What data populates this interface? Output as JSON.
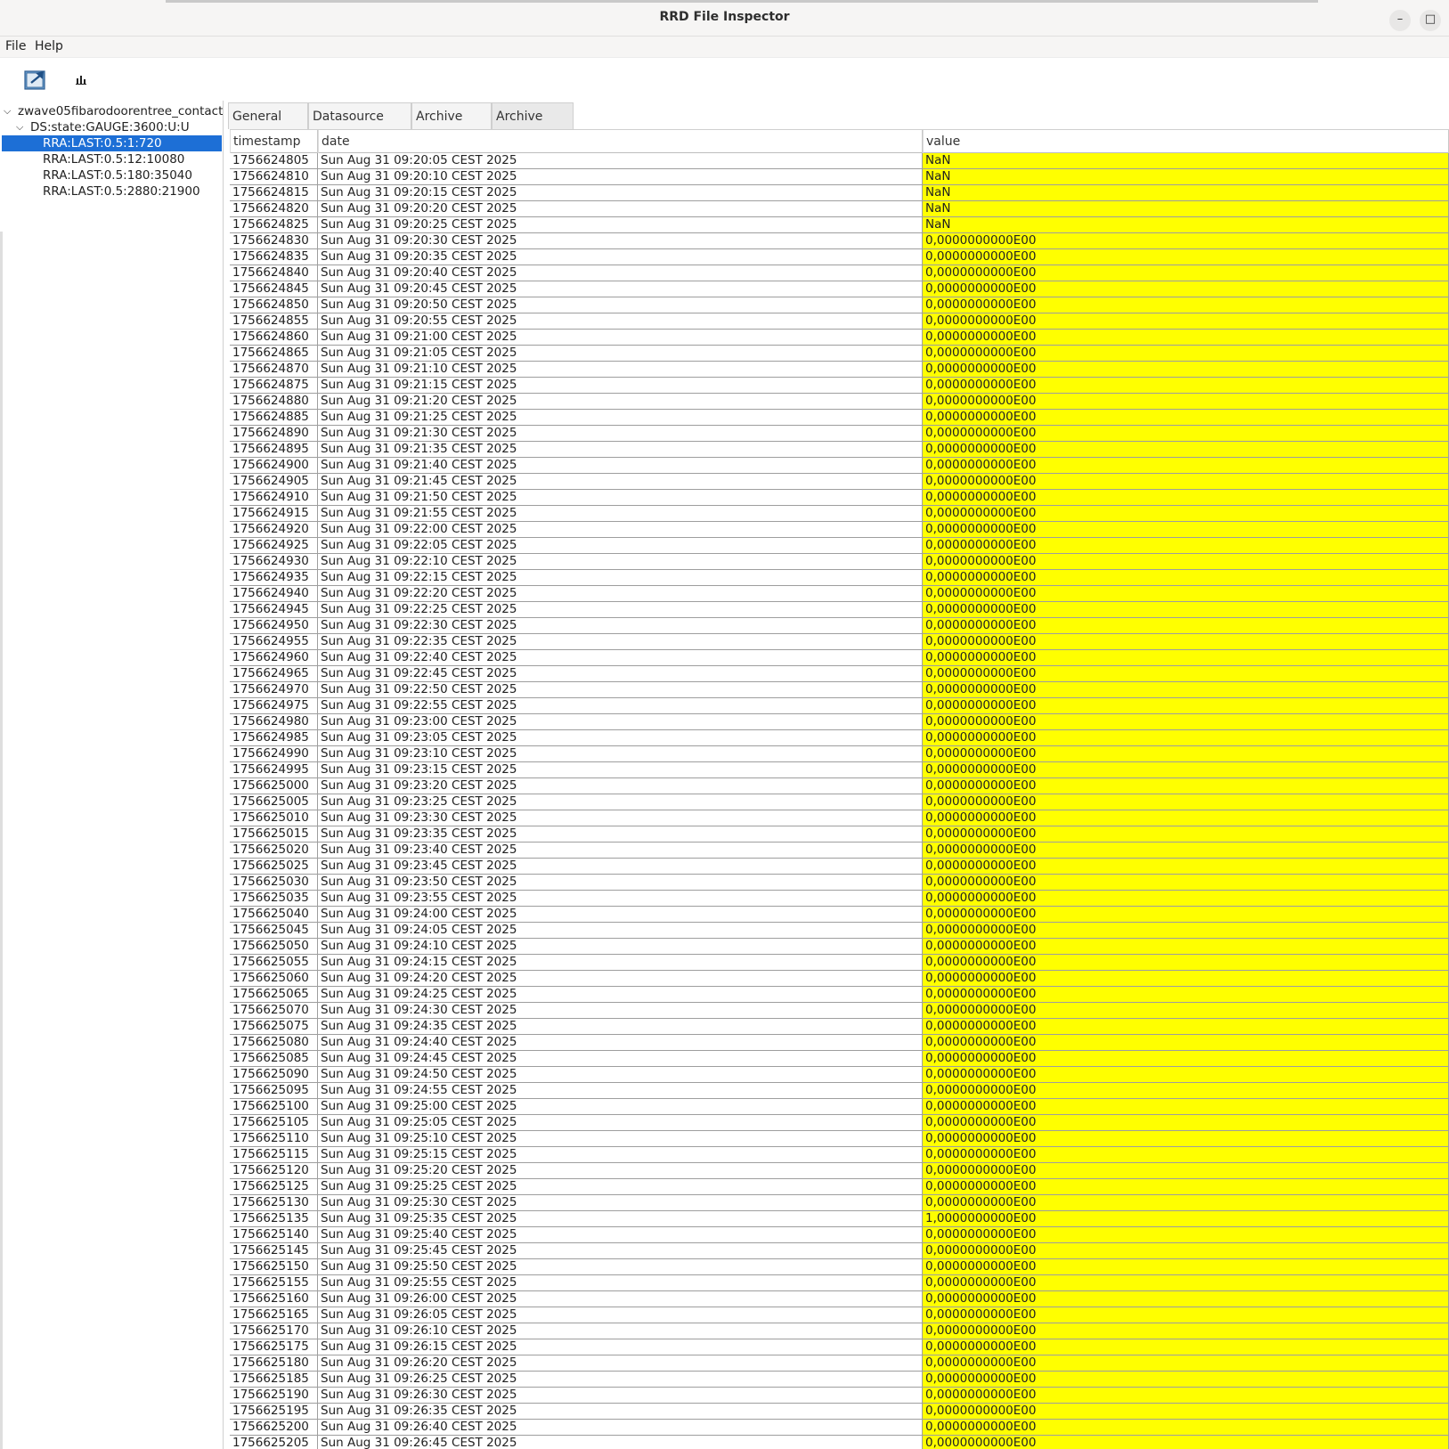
{
  "window": {
    "title": "RRD File Inspector",
    "minimize_glyph": "–",
    "maximize_glyph": "□"
  },
  "menu": {
    "file": "File",
    "help": "Help"
  },
  "toolbar": {
    "open_icon": "open-file-icon",
    "chart_icon": "bar-chart-icon"
  },
  "tree": {
    "root": "zwave05fibarodoorentree_contact",
    "ds": "DS:state:GAUGE:3600:U:U",
    "rras": [
      "RRA:LAST:0.5:1:720",
      "RRA:LAST:0.5:12:10080",
      "RRA:LAST:0.5:180:35040",
      "RRA:LAST:0.5:2880:21900"
    ],
    "selected_index": 0
  },
  "tabs": [
    "General info",
    "Datasource info",
    "Archive info",
    "Archive data"
  ],
  "active_tab": 3,
  "table": {
    "columns": [
      "timestamp",
      "date",
      "value"
    ],
    "value_highlight": "#ffff00",
    "rows": [
      [
        "1756624805",
        "Sun Aug 31 09:20:05 CEST 2025",
        "NaN"
      ],
      [
        "1756624810",
        "Sun Aug 31 09:20:10 CEST 2025",
        "NaN"
      ],
      [
        "1756624815",
        "Sun Aug 31 09:20:15 CEST 2025",
        "NaN"
      ],
      [
        "1756624820",
        "Sun Aug 31 09:20:20 CEST 2025",
        "NaN"
      ],
      [
        "1756624825",
        "Sun Aug 31 09:20:25 CEST 2025",
        "NaN"
      ],
      [
        "1756624830",
        "Sun Aug 31 09:20:30 CEST 2025",
        "0,0000000000E00"
      ],
      [
        "1756624835",
        "Sun Aug 31 09:20:35 CEST 2025",
        "0,0000000000E00"
      ],
      [
        "1756624840",
        "Sun Aug 31 09:20:40 CEST 2025",
        "0,0000000000E00"
      ],
      [
        "1756624845",
        "Sun Aug 31 09:20:45 CEST 2025",
        "0,0000000000E00"
      ],
      [
        "1756624850",
        "Sun Aug 31 09:20:50 CEST 2025",
        "0,0000000000E00"
      ],
      [
        "1756624855",
        "Sun Aug 31 09:20:55 CEST 2025",
        "0,0000000000E00"
      ],
      [
        "1756624860",
        "Sun Aug 31 09:21:00 CEST 2025",
        "0,0000000000E00"
      ],
      [
        "1756624865",
        "Sun Aug 31 09:21:05 CEST 2025",
        "0,0000000000E00"
      ],
      [
        "1756624870",
        "Sun Aug 31 09:21:10 CEST 2025",
        "0,0000000000E00"
      ],
      [
        "1756624875",
        "Sun Aug 31 09:21:15 CEST 2025",
        "0,0000000000E00"
      ],
      [
        "1756624880",
        "Sun Aug 31 09:21:20 CEST 2025",
        "0,0000000000E00"
      ],
      [
        "1756624885",
        "Sun Aug 31 09:21:25 CEST 2025",
        "0,0000000000E00"
      ],
      [
        "1756624890",
        "Sun Aug 31 09:21:30 CEST 2025",
        "0,0000000000E00"
      ],
      [
        "1756624895",
        "Sun Aug 31 09:21:35 CEST 2025",
        "0,0000000000E00"
      ],
      [
        "1756624900",
        "Sun Aug 31 09:21:40 CEST 2025",
        "0,0000000000E00"
      ],
      [
        "1756624905",
        "Sun Aug 31 09:21:45 CEST 2025",
        "0,0000000000E00"
      ],
      [
        "1756624910",
        "Sun Aug 31 09:21:50 CEST 2025",
        "0,0000000000E00"
      ],
      [
        "1756624915",
        "Sun Aug 31 09:21:55 CEST 2025",
        "0,0000000000E00"
      ],
      [
        "1756624920",
        "Sun Aug 31 09:22:00 CEST 2025",
        "0,0000000000E00"
      ],
      [
        "1756624925",
        "Sun Aug 31 09:22:05 CEST 2025",
        "0,0000000000E00"
      ],
      [
        "1756624930",
        "Sun Aug 31 09:22:10 CEST 2025",
        "0,0000000000E00"
      ],
      [
        "1756624935",
        "Sun Aug 31 09:22:15 CEST 2025",
        "0,0000000000E00"
      ],
      [
        "1756624940",
        "Sun Aug 31 09:22:20 CEST 2025",
        "0,0000000000E00"
      ],
      [
        "1756624945",
        "Sun Aug 31 09:22:25 CEST 2025",
        "0,0000000000E00"
      ],
      [
        "1756624950",
        "Sun Aug 31 09:22:30 CEST 2025",
        "0,0000000000E00"
      ],
      [
        "1756624955",
        "Sun Aug 31 09:22:35 CEST 2025",
        "0,0000000000E00"
      ],
      [
        "1756624960",
        "Sun Aug 31 09:22:40 CEST 2025",
        "0,0000000000E00"
      ],
      [
        "1756624965",
        "Sun Aug 31 09:22:45 CEST 2025",
        "0,0000000000E00"
      ],
      [
        "1756624970",
        "Sun Aug 31 09:22:50 CEST 2025",
        "0,0000000000E00"
      ],
      [
        "1756624975",
        "Sun Aug 31 09:22:55 CEST 2025",
        "0,0000000000E00"
      ],
      [
        "1756624980",
        "Sun Aug 31 09:23:00 CEST 2025",
        "0,0000000000E00"
      ],
      [
        "1756624985",
        "Sun Aug 31 09:23:05 CEST 2025",
        "0,0000000000E00"
      ],
      [
        "1756624990",
        "Sun Aug 31 09:23:10 CEST 2025",
        "0,0000000000E00"
      ],
      [
        "1756624995",
        "Sun Aug 31 09:23:15 CEST 2025",
        "0,0000000000E00"
      ],
      [
        "1756625000",
        "Sun Aug 31 09:23:20 CEST 2025",
        "0,0000000000E00"
      ],
      [
        "1756625005",
        "Sun Aug 31 09:23:25 CEST 2025",
        "0,0000000000E00"
      ],
      [
        "1756625010",
        "Sun Aug 31 09:23:30 CEST 2025",
        "0,0000000000E00"
      ],
      [
        "1756625015",
        "Sun Aug 31 09:23:35 CEST 2025",
        "0,0000000000E00"
      ],
      [
        "1756625020",
        "Sun Aug 31 09:23:40 CEST 2025",
        "0,0000000000E00"
      ],
      [
        "1756625025",
        "Sun Aug 31 09:23:45 CEST 2025",
        "0,0000000000E00"
      ],
      [
        "1756625030",
        "Sun Aug 31 09:23:50 CEST 2025",
        "0,0000000000E00"
      ],
      [
        "1756625035",
        "Sun Aug 31 09:23:55 CEST 2025",
        "0,0000000000E00"
      ],
      [
        "1756625040",
        "Sun Aug 31 09:24:00 CEST 2025",
        "0,0000000000E00"
      ],
      [
        "1756625045",
        "Sun Aug 31 09:24:05 CEST 2025",
        "0,0000000000E00"
      ],
      [
        "1756625050",
        "Sun Aug 31 09:24:10 CEST 2025",
        "0,0000000000E00"
      ],
      [
        "1756625055",
        "Sun Aug 31 09:24:15 CEST 2025",
        "0,0000000000E00"
      ],
      [
        "1756625060",
        "Sun Aug 31 09:24:20 CEST 2025",
        "0,0000000000E00"
      ],
      [
        "1756625065",
        "Sun Aug 31 09:24:25 CEST 2025",
        "0,0000000000E00"
      ],
      [
        "1756625070",
        "Sun Aug 31 09:24:30 CEST 2025",
        "0,0000000000E00"
      ],
      [
        "1756625075",
        "Sun Aug 31 09:24:35 CEST 2025",
        "0,0000000000E00"
      ],
      [
        "1756625080",
        "Sun Aug 31 09:24:40 CEST 2025",
        "0,0000000000E00"
      ],
      [
        "1756625085",
        "Sun Aug 31 09:24:45 CEST 2025",
        "0,0000000000E00"
      ],
      [
        "1756625090",
        "Sun Aug 31 09:24:50 CEST 2025",
        "0,0000000000E00"
      ],
      [
        "1756625095",
        "Sun Aug 31 09:24:55 CEST 2025",
        "0,0000000000E00"
      ],
      [
        "1756625100",
        "Sun Aug 31 09:25:00 CEST 2025",
        "0,0000000000E00"
      ],
      [
        "1756625105",
        "Sun Aug 31 09:25:05 CEST 2025",
        "0,0000000000E00"
      ],
      [
        "1756625110",
        "Sun Aug 31 09:25:10 CEST 2025",
        "0,0000000000E00"
      ],
      [
        "1756625115",
        "Sun Aug 31 09:25:15 CEST 2025",
        "0,0000000000E00"
      ],
      [
        "1756625120",
        "Sun Aug 31 09:25:20 CEST 2025",
        "0,0000000000E00"
      ],
      [
        "1756625125",
        "Sun Aug 31 09:25:25 CEST 2025",
        "0,0000000000E00"
      ],
      [
        "1756625130",
        "Sun Aug 31 09:25:30 CEST 2025",
        "0,0000000000E00"
      ],
      [
        "1756625135",
        "Sun Aug 31 09:25:35 CEST 2025",
        "1,0000000000E00"
      ],
      [
        "1756625140",
        "Sun Aug 31 09:25:40 CEST 2025",
        "0,0000000000E00"
      ],
      [
        "1756625145",
        "Sun Aug 31 09:25:45 CEST 2025",
        "0,0000000000E00"
      ],
      [
        "1756625150",
        "Sun Aug 31 09:25:50 CEST 2025",
        "0,0000000000E00"
      ],
      [
        "1756625155",
        "Sun Aug 31 09:25:55 CEST 2025",
        "0,0000000000E00"
      ],
      [
        "1756625160",
        "Sun Aug 31 09:26:00 CEST 2025",
        "0,0000000000E00"
      ],
      [
        "1756625165",
        "Sun Aug 31 09:26:05 CEST 2025",
        "0,0000000000E00"
      ],
      [
        "1756625170",
        "Sun Aug 31 09:26:10 CEST 2025",
        "0,0000000000E00"
      ],
      [
        "1756625175",
        "Sun Aug 31 09:26:15 CEST 2025",
        "0,0000000000E00"
      ],
      [
        "1756625180",
        "Sun Aug 31 09:26:20 CEST 2025",
        "0,0000000000E00"
      ],
      [
        "1756625185",
        "Sun Aug 31 09:26:25 CEST 2025",
        "0,0000000000E00"
      ],
      [
        "1756625190",
        "Sun Aug 31 09:26:30 CEST 2025",
        "0,0000000000E00"
      ],
      [
        "1756625195",
        "Sun Aug 31 09:26:35 CEST 2025",
        "0,0000000000E00"
      ],
      [
        "1756625200",
        "Sun Aug 31 09:26:40 CEST 2025",
        "0,0000000000E00"
      ],
      [
        "1756625205",
        "Sun Aug 31 09:26:45 CEST 2025",
        "0,0000000000E00"
      ]
    ]
  }
}
